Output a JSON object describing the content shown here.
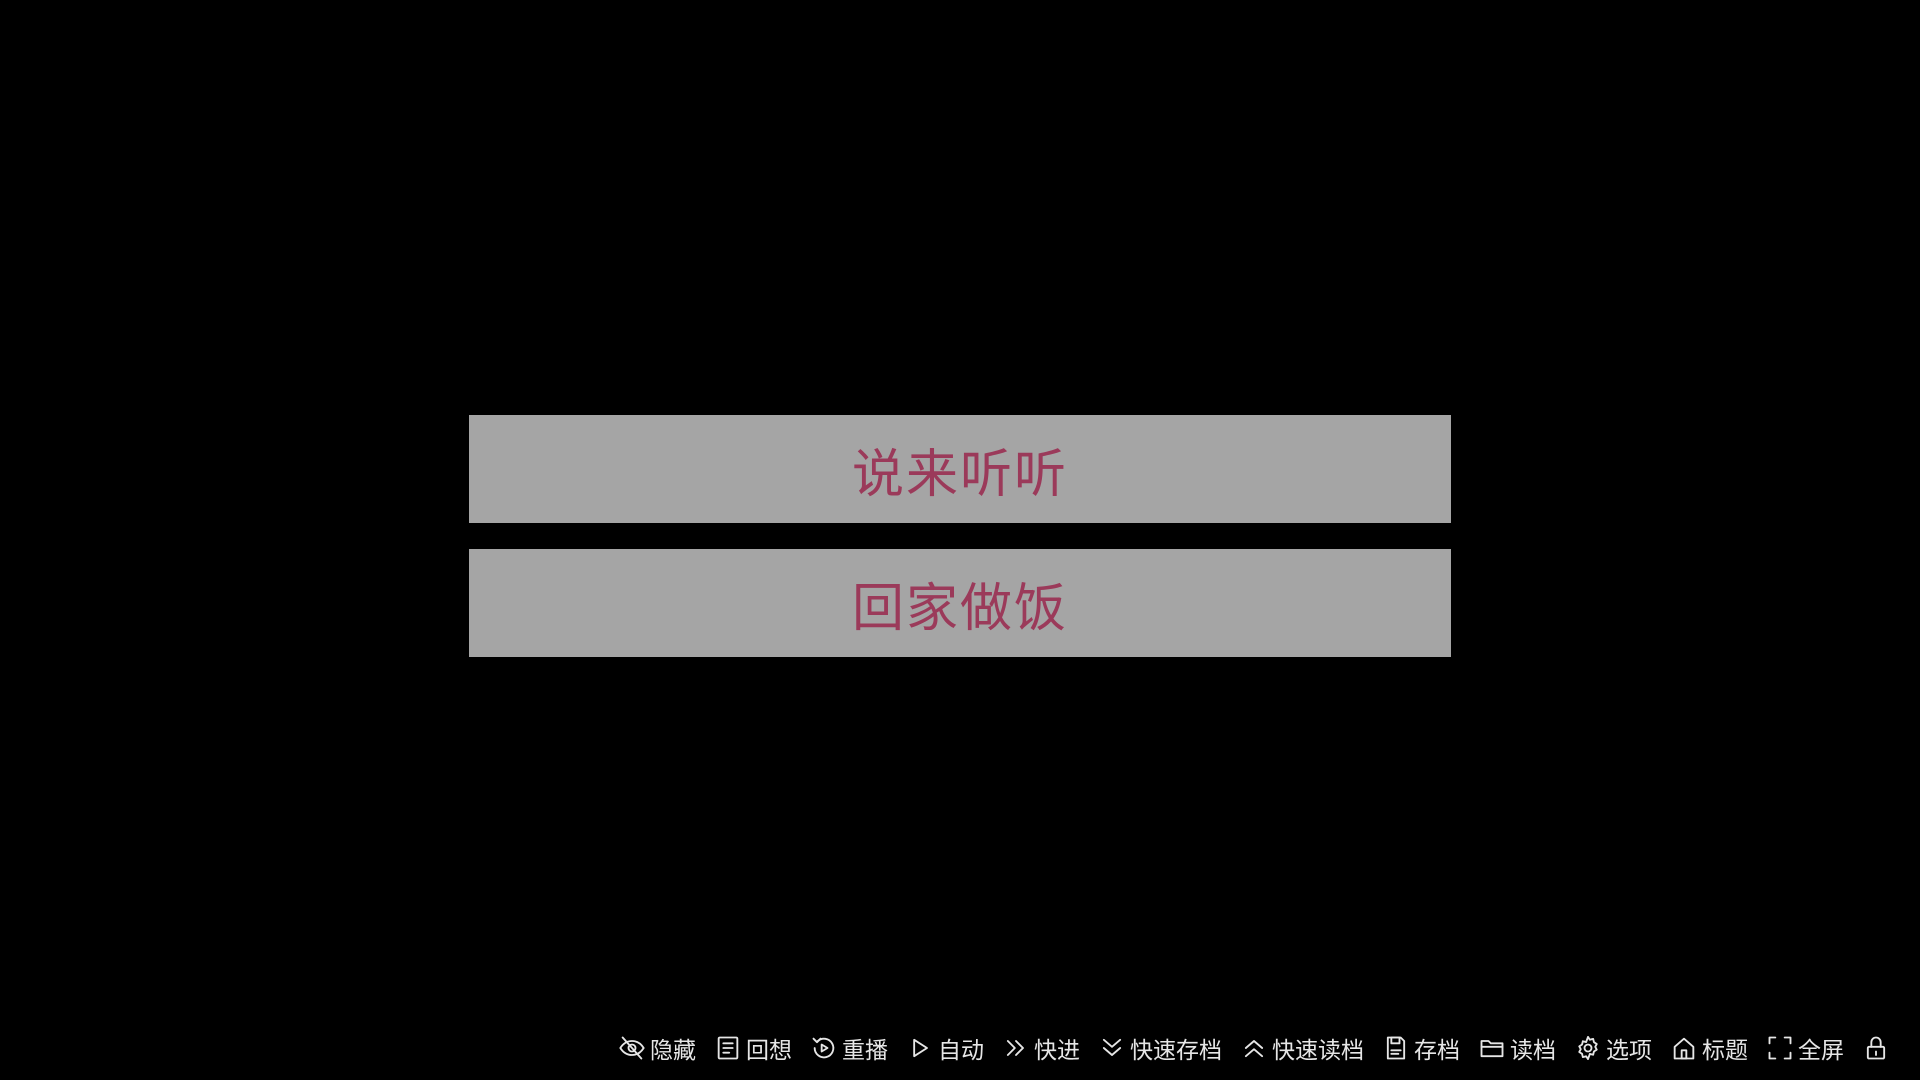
{
  "choices": [
    {
      "label": "说来听听"
    },
    {
      "label": "回家做饭"
    }
  ],
  "toolbar": {
    "items": [
      {
        "label": "隐藏",
        "icon": "eye-off-icon"
      },
      {
        "label": "回想",
        "icon": "list-icon"
      },
      {
        "label": "重播",
        "icon": "replay-icon"
      },
      {
        "label": "自动",
        "icon": "play-icon"
      },
      {
        "label": "快进",
        "icon": "fast-forward-icon"
      },
      {
        "label": "快速存档",
        "icon": "chevron-down-icon"
      },
      {
        "label": "快速读档",
        "icon": "chevron-up-icon"
      },
      {
        "label": "存档",
        "icon": "save-icon"
      },
      {
        "label": "读档",
        "icon": "folder-icon"
      },
      {
        "label": "选项",
        "icon": "gear-icon"
      },
      {
        "label": "标题",
        "icon": "home-icon"
      },
      {
        "label": "全屏",
        "icon": "fullscreen-icon"
      }
    ],
    "lock_icon": "lock-icon"
  },
  "colors": {
    "background": "#000000",
    "choice_background": "#a5a5a5",
    "choice_text": "#9b3a5a",
    "toolbar_text": "#e6e6e6"
  }
}
